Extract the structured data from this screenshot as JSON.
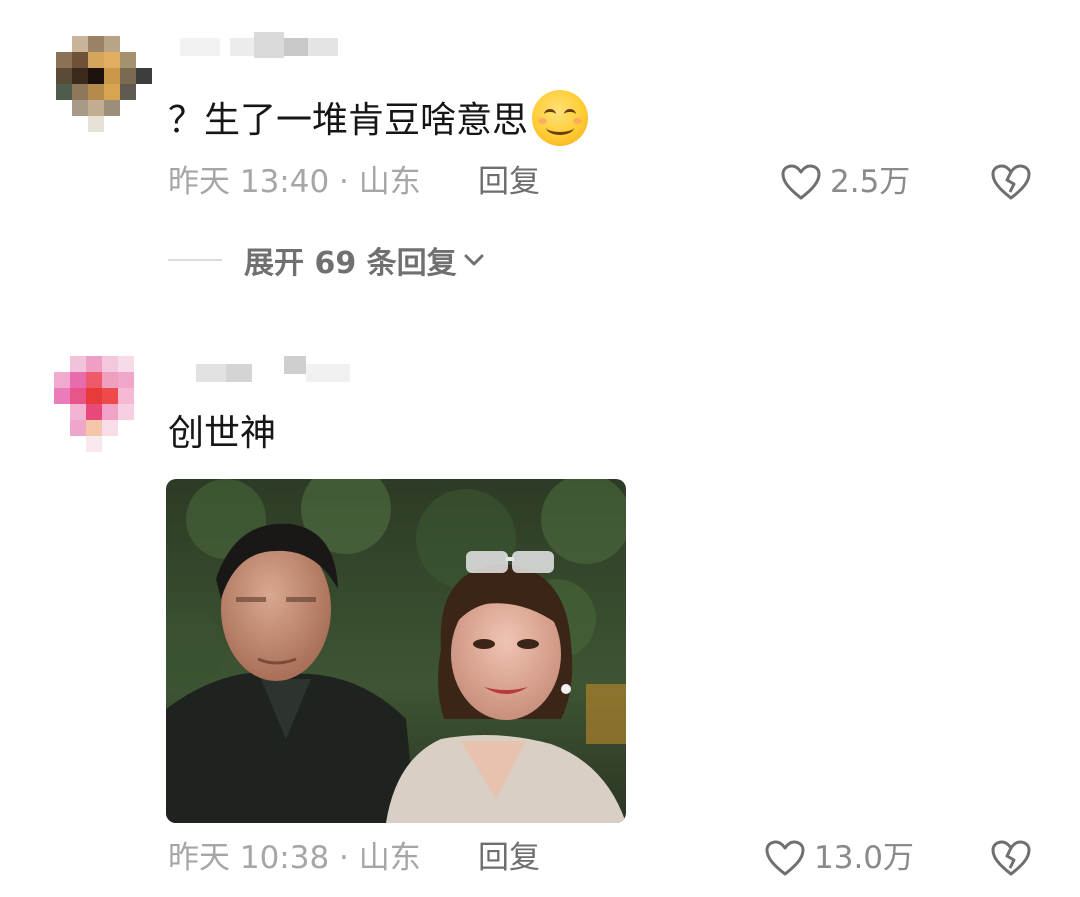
{
  "comments": [
    {
      "text": "？生了一堆肯豆啥意思",
      "emoji": "smiling-face-emoji",
      "meta": "昨天 13:40 · 山东",
      "reply_label": "回复",
      "likes": "2.5万",
      "expand_label": "展开 69 条回复"
    },
    {
      "text": "创世神",
      "meta": "昨天 10:38 · 山东",
      "reply_label": "回复",
      "likes": "13.0万"
    }
  ],
  "colors": {
    "meta": "#a6a6a6",
    "reply": "#6e6e6e",
    "text": "#161616"
  },
  "icons": [
    "heart-outline-icon",
    "broken-heart-icon",
    "chevron-down-icon"
  ]
}
